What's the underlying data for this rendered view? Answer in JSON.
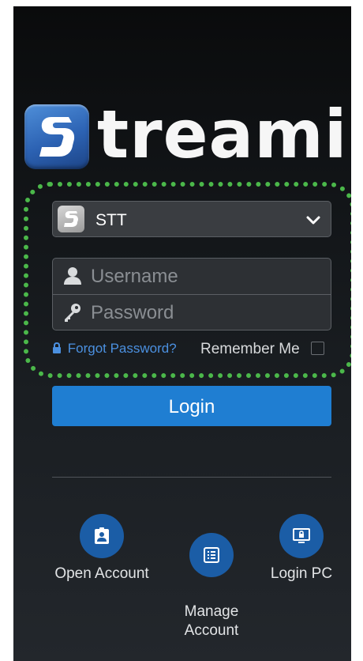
{
  "logo": {
    "wordmark": "treaming"
  },
  "broker": {
    "name": "STT"
  },
  "login_form": {
    "username_placeholder": "Username",
    "password_placeholder": "Password",
    "forgot_password": "Forgot Password?",
    "remember_me": "Remember Me",
    "login_button": "Login"
  },
  "actions": [
    {
      "label": "Open Account",
      "icon": "id-badge-icon"
    },
    {
      "label": "Manage\nAccount",
      "icon": "list-document-icon"
    },
    {
      "label": "Login PC",
      "icon": "monitor-lock-icon"
    }
  ],
  "colors": {
    "accent": "#1f7ed2",
    "link": "#4b90e0",
    "icon_circle": "#1b5da6",
    "highlight": "#4bb84a"
  }
}
